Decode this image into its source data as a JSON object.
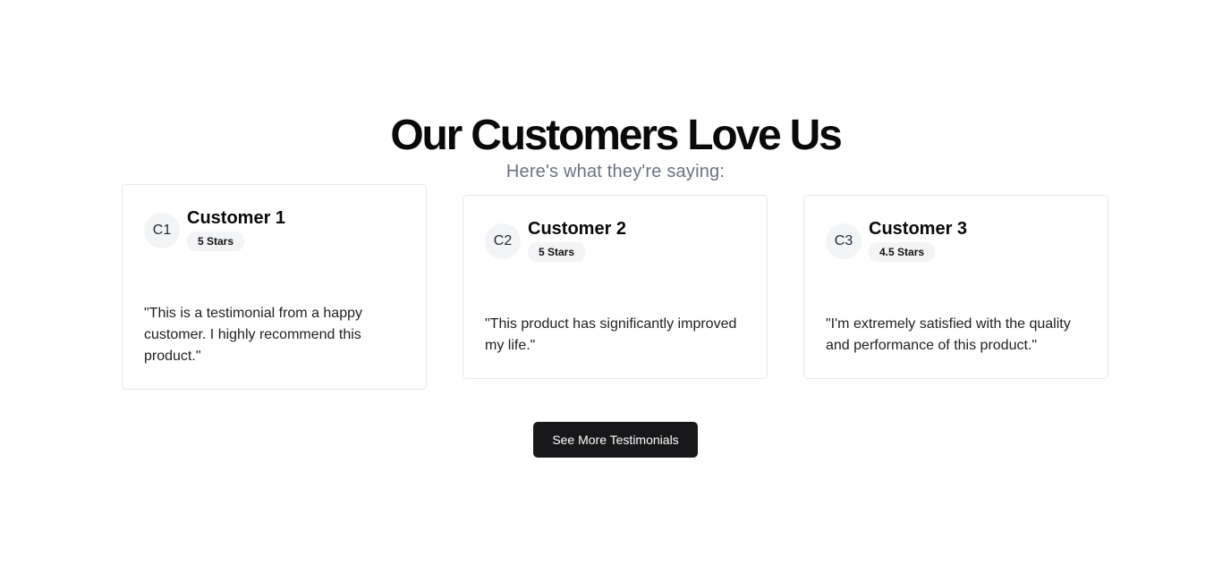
{
  "header": {
    "title": "Our Customers Love Us",
    "subtitle": "Here's what they're saying:"
  },
  "testimonials": [
    {
      "initials": "C1",
      "name": "Customer 1",
      "rating": "5 Stars",
      "quote": "\"This is a testimonial from a happy customer. I highly recommend this product.\""
    },
    {
      "initials": "C2",
      "name": "Customer 2",
      "rating": "5 Stars",
      "quote": "\"This product has significantly improved my life.\""
    },
    {
      "initials": "C3",
      "name": "Customer 3",
      "rating": "4.5 Stars",
      "quote": "\"I'm extremely satisfied with the quality and performance of this product.\""
    }
  ],
  "cta": {
    "label": "See More Testimonials"
  },
  "colors": {
    "button_background": "#18181b",
    "button_text": "#ffffff",
    "subtitle_text": "#6b7280",
    "card_border": "#e5e7eb",
    "badge_background": "#f3f4f6"
  }
}
